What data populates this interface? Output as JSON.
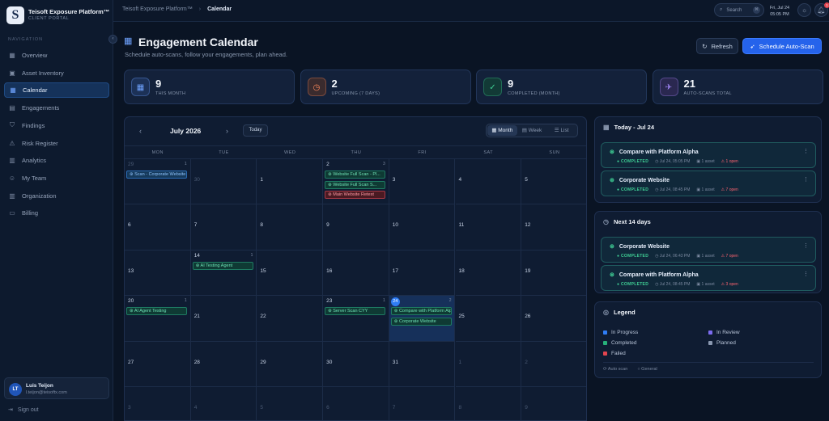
{
  "app": {
    "title": "Teisoft Exposure Platform™",
    "subtitle": "CLIENT PORTAL",
    "logo_letter": "S"
  },
  "sidebar": {
    "section_label": "NAVIGATION",
    "collapse_icon": "‹",
    "items": [
      {
        "label": "Overview",
        "icon": "grid-icon"
      },
      {
        "label": "Asset Inventory",
        "icon": "box-icon"
      },
      {
        "label": "Calendar",
        "icon": "calendar-icon",
        "active": true
      },
      {
        "label": "Engagements",
        "icon": "briefcase-icon"
      },
      {
        "label": "Findings",
        "icon": "shield-icon"
      },
      {
        "label": "Risk Register",
        "icon": "warning-icon"
      },
      {
        "label": "Analytics",
        "icon": "chart-icon"
      },
      {
        "label": "My Team",
        "icon": "users-icon"
      },
      {
        "label": "Organization",
        "icon": "building-icon"
      },
      {
        "label": "Billing",
        "icon": "card-icon"
      }
    ],
    "user": {
      "initials": "LT",
      "name": "Luis Teijon",
      "email": "l.teijon@teisoftx.com"
    },
    "signout": "Sign out"
  },
  "topbar": {
    "crumb_parent": "Teisoft Exposure Platform™",
    "crumb_current": "Calendar",
    "search": "Search",
    "date": "Fri, Jul 24",
    "time": "05:05 PM",
    "notif_count": "1"
  },
  "header": {
    "title": "Engagement Calendar",
    "subtitle": "Schedule auto-scans, follow your engagements, plan ahead.",
    "refresh": "Refresh",
    "schedule": "Schedule Auto-Scan"
  },
  "stats": [
    {
      "value": "9",
      "label": "THIS MONTH",
      "color": "#6fa3ff",
      "bg": "#1c3157"
    },
    {
      "value": "2",
      "label": "UPCOMING (7 DAYS)",
      "color": "#ff8a5c",
      "bg": "#3a2b2e"
    },
    {
      "value": "9",
      "label": "COMPLETED (MONTH)",
      "color": "#3fcf95",
      "bg": "#123a36"
    },
    {
      "value": "21",
      "label": "AUTO-SCANS TOTAL",
      "color": "#a78bff",
      "bg": "#2a2850"
    }
  ],
  "calendar": {
    "month": "July 2026",
    "today_label": "Today",
    "views": [
      "Month",
      "Week",
      "List"
    ],
    "dow": [
      "MON",
      "TUE",
      "WED",
      "THU",
      "FRI",
      "SAT",
      "SUN"
    ],
    "weeks": [
      [
        {
          "d": "29",
          "o": true,
          "cnt": "1",
          "ev": [
            {
              "t": "Scan - Corporate Website",
              "c": "blue"
            }
          ]
        },
        {
          "d": "30",
          "o": true
        },
        {
          "d": "1"
        },
        {
          "d": "2",
          "cnt": "3",
          "ev": [
            {
              "t": "Website Full Scan - Pl...",
              "c": "green"
            },
            {
              "t": "Website Full Scan S...",
              "c": "green"
            },
            {
              "t": "Main Website Retest",
              "c": "red"
            }
          ]
        },
        {
          "d": "3"
        },
        {
          "d": "4"
        },
        {
          "d": "5"
        }
      ],
      [
        {
          "d": "6"
        },
        {
          "d": "7"
        },
        {
          "d": "8"
        },
        {
          "d": "9"
        },
        {
          "d": "10"
        },
        {
          "d": "11"
        },
        {
          "d": "12"
        }
      ],
      [
        {
          "d": "13"
        },
        {
          "d": "14",
          "cnt": "1",
          "ev": [
            {
              "t": "AI Testing Agent",
              "c": "green"
            }
          ]
        },
        {
          "d": "15"
        },
        {
          "d": "16"
        },
        {
          "d": "17"
        },
        {
          "d": "18"
        },
        {
          "d": "19"
        }
      ],
      [
        {
          "d": "20",
          "cnt": "1",
          "ev": [
            {
              "t": "AI Agent Testing",
              "c": "green"
            }
          ]
        },
        {
          "d": "21"
        },
        {
          "d": "22"
        },
        {
          "d": "23",
          "cnt": "1",
          "ev": [
            {
              "t": "Server Scan CYY",
              "c": "green"
            }
          ]
        },
        {
          "d": "24",
          "today": true,
          "cnt": "2",
          "ev": [
            {
              "t": "Compare with Platform Alpha",
              "c": "green"
            },
            {
              "t": "Corporate Website",
              "c": "green"
            }
          ]
        },
        {
          "d": "25"
        },
        {
          "d": "26"
        }
      ],
      [
        {
          "d": "27"
        },
        {
          "d": "28"
        },
        {
          "d": "29"
        },
        {
          "d": "30"
        },
        {
          "d": "31"
        },
        {
          "d": "1",
          "o": true
        },
        {
          "d": "2",
          "o": true
        }
      ],
      [
        {
          "d": "3",
          "o": true
        },
        {
          "d": "4",
          "o": true
        },
        {
          "d": "5",
          "o": true
        },
        {
          "d": "6",
          "o": true
        },
        {
          "d": "7",
          "o": true
        },
        {
          "d": "8",
          "o": true
        },
        {
          "d": "9",
          "o": true
        }
      ]
    ]
  },
  "today_panel": {
    "title": "Today - Jul 24",
    "items": [
      {
        "name": "Compare with Platform Alpha",
        "status": "COMPLETED",
        "time": "Jul 24, 05:05 PM",
        "assets": "1 asset",
        "open": "1 open"
      },
      {
        "name": "Corporate Website",
        "status": "COMPLETED",
        "time": "Jul 24, 08:45 PM",
        "assets": "1 asset",
        "open": "7 open"
      }
    ]
  },
  "next_panel": {
    "title": "Next 14 days",
    "items": [
      {
        "name": "Corporate Website",
        "status": "COMPLETED",
        "time": "Jul 24, 06:43 PM",
        "assets": "1 asset",
        "open": "7 open"
      },
      {
        "name": "Compare with Platform Alpha",
        "status": "COMPLETED",
        "time": "Jul 24, 08:45 PM",
        "assets": "1 asset",
        "open": "3 open"
      }
    ]
  },
  "legend": {
    "title": "Legend",
    "items": [
      {
        "label": "In Progress",
        "color": "#2f7df6"
      },
      {
        "label": "In Review",
        "color": "#7c6cf0"
      },
      {
        "label": "Completed",
        "color": "#27b07a"
      },
      {
        "label": "Planned",
        "color": "#8a98b0"
      },
      {
        "label": "Failed",
        "color": "#e2454f"
      }
    ],
    "footer": [
      "Auto scan",
      "General"
    ]
  }
}
